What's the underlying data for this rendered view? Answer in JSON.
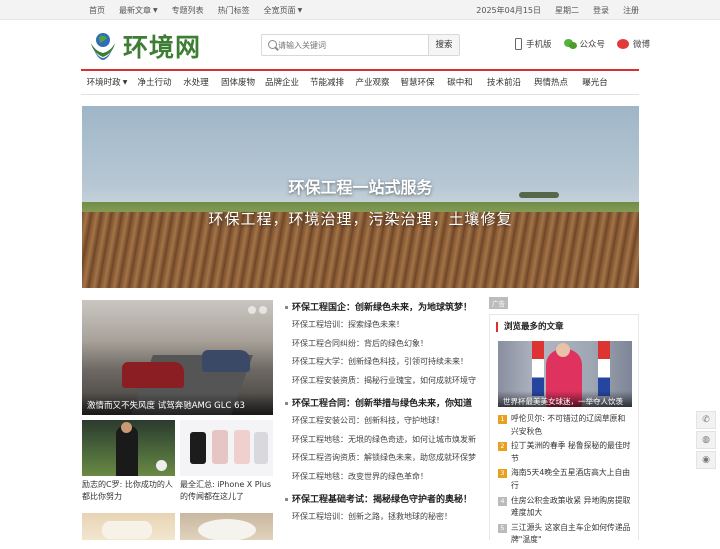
{
  "topbar": {
    "left": [
      "首页",
      "最新文章",
      "专题列表",
      "热门标签",
      "全宽页面"
    ],
    "date": "2025年04月15日",
    "weekday": "星期二",
    "login": "登录",
    "register": "注册"
  },
  "header": {
    "logo_text": "环境网",
    "search_placeholder": "请输入关键词",
    "search_button": "搜索",
    "mobile_label": "手机版",
    "wechat_label": "公众号",
    "weibo_label": "微博"
  },
  "nav": [
    "环境时政",
    "净土行动",
    "水处理",
    "固体废物",
    "品牌企业",
    "节能减排",
    "产业观察",
    "智慧环保",
    "碳中和",
    "技术前沿",
    "舆情热点",
    "曝光台"
  ],
  "banner": {
    "title": "环保工程一站式服务",
    "subtitle": "环保工程，环境治理，污染治理，土壤修复"
  },
  "left": {
    "feature_caption": "激情而又不失风度 试驾奔驰AMG GLC 63",
    "thumbs": [
      {
        "caption": "励志的C罗: 比你成功的人都比你努力"
      },
      {
        "caption": "最全汇总: iPhone X Plus的传闻都在这儿了"
      }
    ]
  },
  "news": {
    "groups": [
      {
        "headline": "环保工程国企：创新绿色未来，为地球筑梦！",
        "items": [
          "环保工程培训：探索绿色未来！",
          "环保工程合同纠纷：背后的绿色幻象！",
          "环保工程大学：创新绿色科技，引领可持续未来！",
          "环保工程安装资质：揭秘行业瑰宝，如何成就环境守"
        ]
      },
      {
        "headline": "环保工程合同：创新举措与绿色未来，你知道",
        "items": [
          "环保工程安装公司：创新科技，守护地球！",
          "环保工程地毯：无垠的绿色奇迹，如何让城市焕发新",
          "环保工程咨询资质：解锁绿色未来，助您成就环保梦",
          "环保工程地毯：改变世界的绿色革命！"
        ]
      },
      {
        "headline": "环保工程基础考试：揭秘绿色守护者的奥秘！",
        "items": [
          "环保工程培训：创新之路，拯救地球的秘密！"
        ]
      }
    ]
  },
  "sidebar": {
    "ad_tag": "广告",
    "title": "浏览最多的文章",
    "photo_caption": "世界杯最美美女球迷，一举夺人饮羡",
    "ranks": [
      {
        "num": "1",
        "text": "呼伦贝尔: 不可错过的辽阔草原和兴安秋色"
      },
      {
        "num": "2",
        "text": "拉丁美洲的春季 秘鲁探秘的最佳时节"
      },
      {
        "num": "3",
        "text": "海南5天4晚全五星酒店高大上自由行"
      },
      {
        "num": "4",
        "text": "住房公积金政策收紧 异地购房提取难度加大"
      },
      {
        "num": "5",
        "text": "三江源头 这家自主车企如何传递品牌\"温度\""
      }
    ]
  },
  "colors": {
    "accent": "#d82f2f",
    "brand_green": "#3e7d34",
    "hot_rank": "#e8a021"
  },
  "float_icons": [
    "phone-icon",
    "wechat-icon",
    "weibo-icon"
  ]
}
